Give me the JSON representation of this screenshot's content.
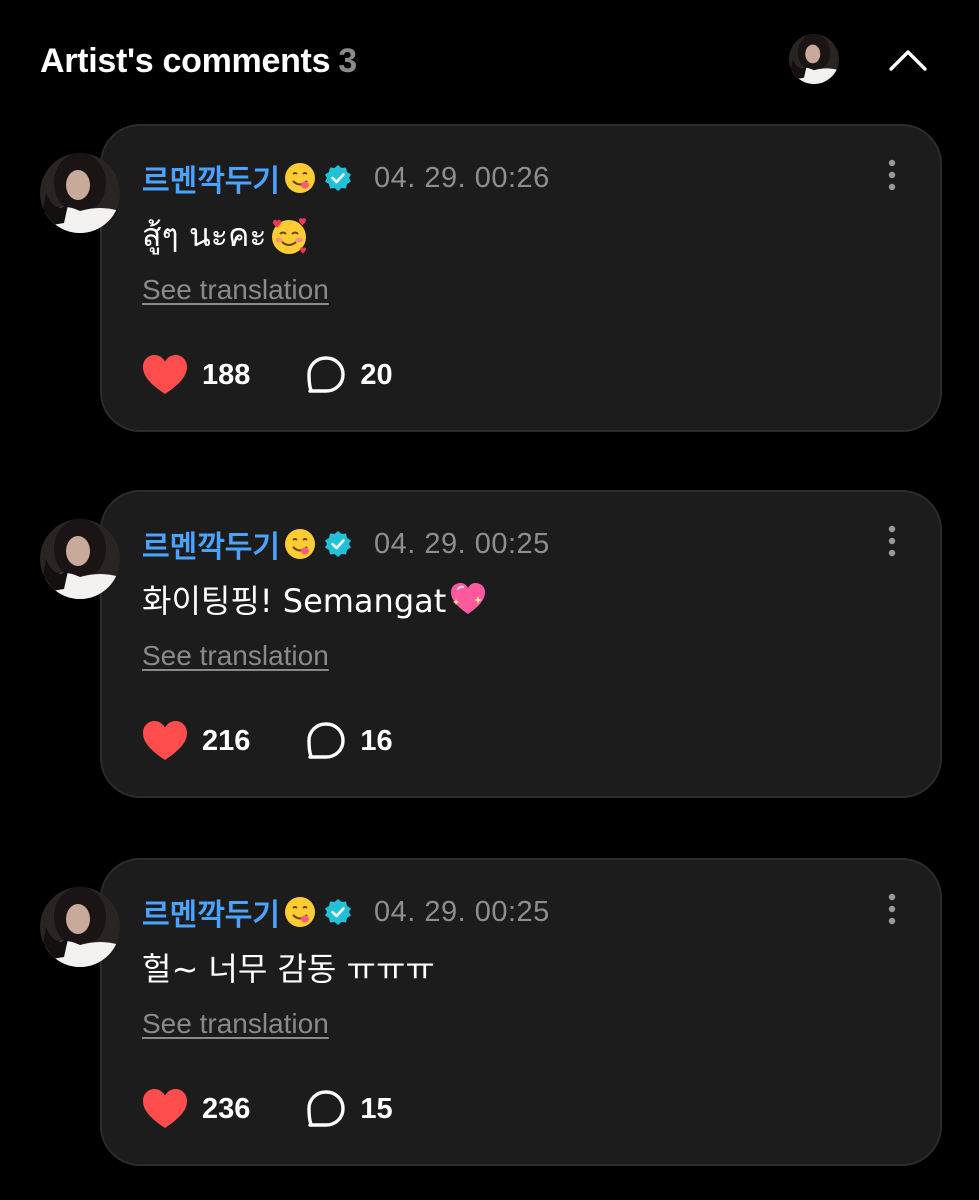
{
  "header": {
    "title": "Artist's comments",
    "count": "3",
    "collapse_icon": "chevron-up-icon"
  },
  "colors": {
    "background": "#000000",
    "card": "#1c1c1c",
    "author": "#4aa3ff",
    "verified": "#22c1d6",
    "like": "#ff4d4d",
    "muted": "#8e8e8e"
  },
  "comments": [
    {
      "author": "르멘깍두기",
      "author_emoji": "savoring-face-emoji",
      "timestamp": "04. 29. 00:26",
      "text": "สู้ๆ นะคะ",
      "text_emoji": "smiling-face-with-hearts-emoji",
      "see_translation": "See translation",
      "likes": "188",
      "replies": "20"
    },
    {
      "author": "르멘깍두기",
      "author_emoji": "savoring-face-emoji",
      "timestamp": "04. 29. 00:25",
      "text": "화이팅핑! Semangat",
      "text_emoji": "sparkling-heart-emoji",
      "see_translation": "See translation",
      "likes": "216",
      "replies": "16"
    },
    {
      "author": "르멘깍두기",
      "author_emoji": "savoring-face-emoji",
      "timestamp": "04. 29. 00:25",
      "text": "헐~ 너무 감동 ㅠㅠㅠ",
      "text_emoji": "",
      "see_translation": "See translation",
      "likes": "236",
      "replies": "15"
    }
  ]
}
